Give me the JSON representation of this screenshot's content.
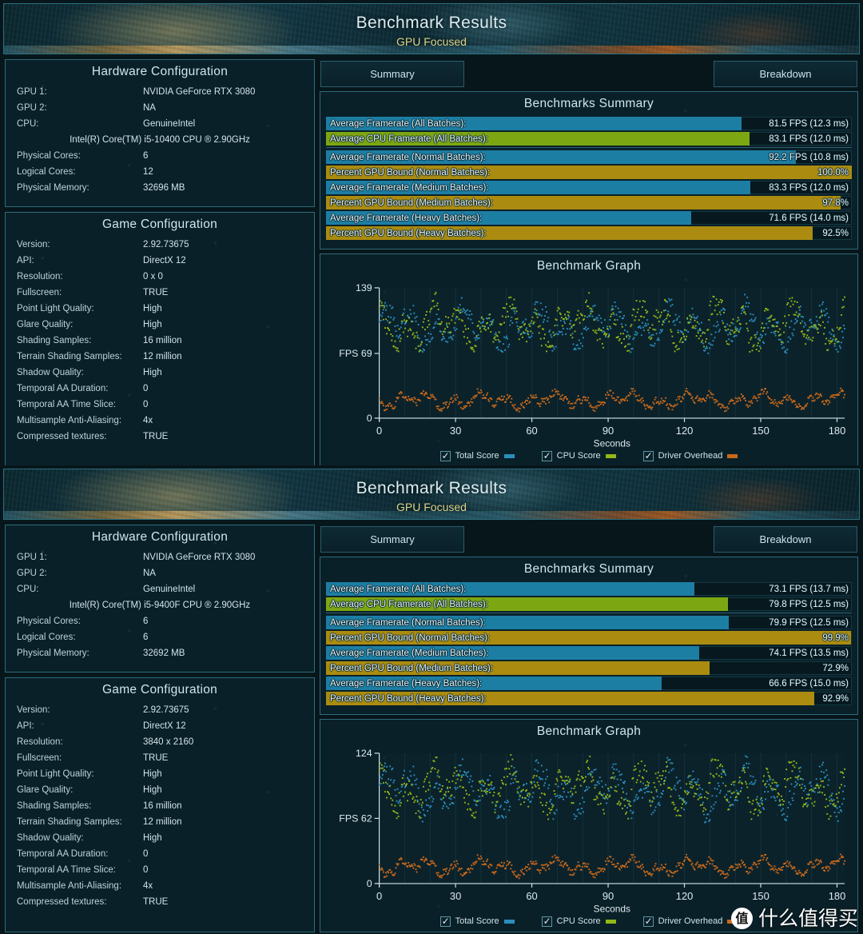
{
  "watermark": {
    "logo_char": "值",
    "text": "什么值得买"
  },
  "panels": [
    {
      "banner": {
        "title": "Benchmark Results",
        "subtitle": "GPU Focused"
      },
      "tabs": [
        {
          "label": "Summary"
        },
        {
          "label": "Breakdown"
        }
      ],
      "hardware": {
        "title": "Hardware Configuration",
        "rows": [
          {
            "key": "GPU 1:",
            "value": "NVIDIA GeForce RTX 3080"
          },
          {
            "key": "GPU 2:",
            "value": "NA"
          },
          {
            "key": "CPU:",
            "value": "GenuineIntel"
          },
          {
            "full": "Intel(R) Core(TM) i5-10400 CPU ® 2.90GHz"
          },
          {
            "key": "Physical Cores:",
            "value": "6"
          },
          {
            "key": "Logical Cores:",
            "value": "12"
          },
          {
            "key": "Physical Memory:",
            "value": "32696  MB"
          }
        ]
      },
      "game": {
        "title": "Game Configuration",
        "rows": [
          {
            "key": "Version:",
            "value": "2.92.73675"
          },
          {
            "key": "API:",
            "value": "DirectX 12"
          },
          {
            "key": "Resolution:",
            "value": "0 x 0"
          },
          {
            "key": "Fullscreen:",
            "value": "TRUE"
          },
          {
            "key": "Point Light Quality:",
            "value": "High"
          },
          {
            "key": "Glare Quality:",
            "value": "High"
          },
          {
            "key": "Shading Samples:",
            "value": "16 million"
          },
          {
            "key": "Terrain Shading Samples:",
            "value": "12 million"
          },
          {
            "key": "Shadow Quality:",
            "value": "High"
          },
          {
            "key": "Temporal AA Duration:",
            "value": "0"
          },
          {
            "key": "Temporal AA Time Slice:",
            "value": "0"
          },
          {
            "key": "Multisample Anti-Aliasing:",
            "value": "4x"
          },
          {
            "key": "Compressed textures:",
            "value": "TRUE"
          }
        ]
      },
      "summary": {
        "title": "Benchmarks Summary",
        "bars": [
          {
            "label": "Average Framerate (All Batches):",
            "value": "81.5 FPS (12.3 ms)",
            "color": "blue",
            "pct": 79.0
          },
          {
            "label": "Average CPU Framerate (All Batches):",
            "value": "83.1 FPS (12.0 ms)",
            "color": "green",
            "pct": 80.5
          },
          {
            "label": "Average Framerate (Normal Batches):",
            "value": "92.2 FPS (10.8 ms)",
            "color": "blue",
            "pct": 89.4
          },
          {
            "label": "Percent GPU Bound (Normal Batches):",
            "value": "100.0%",
            "color": "gold",
            "pct": 100.0
          },
          {
            "label": "Average Framerate (Medium Batches):",
            "value": "83.3 FPS (12.0 ms)",
            "color": "blue",
            "pct": 80.7
          },
          {
            "label": "Percent GPU Bound (Medium Batches):",
            "value": "97.8%",
            "color": "gold",
            "pct": 97.8
          },
          {
            "label": "Average Framerate (Heavy Batches):",
            "value": "71.6 FPS (14.0 ms)",
            "color": "blue",
            "pct": 69.5
          },
          {
            "label": "Percent GPU Bound (Heavy Batches):",
            "value": "92.5%",
            "color": "gold",
            "pct": 92.5
          }
        ]
      },
      "graph": {
        "title": "Benchmark Graph",
        "y_top": "139",
        "y_mid_label": "FPS",
        "y_mid": "69",
        "y_bottom": "0",
        "xlabel": "Seconds",
        "xticks": [
          "0",
          "30",
          "60",
          "90",
          "120",
          "150",
          "180"
        ],
        "legend": [
          {
            "label": "Total Score",
            "color": "#2b8fbd"
          },
          {
            "label": "CPU Score",
            "color": "#93b817"
          },
          {
            "label": "Driver Overhead",
            "color": "#c9691a"
          }
        ]
      },
      "chart_data": {
        "type": "scatter",
        "title": "Benchmark Graph",
        "xlabel": "Seconds",
        "ylabel": "FPS",
        "xlim": [
          0,
          183
        ],
        "ylim": [
          0,
          139
        ],
        "yticks": [
          0,
          69,
          139
        ],
        "xticks": [
          0,
          30,
          60,
          90,
          120,
          150,
          180
        ],
        "grid": true,
        "legend_position": "bottom",
        "series": [
          {
            "name": "Total Score",
            "color": "#2b8fbd",
            "mean": 97,
            "min": 69,
            "max": 132
          },
          {
            "name": "CPU Score",
            "color": "#93b817",
            "mean": 99,
            "min": 70,
            "max": 138
          },
          {
            "name": "Driver Overhead",
            "color": "#c9691a",
            "mean": 19,
            "min": 7,
            "max": 32
          }
        ]
      }
    },
    {
      "banner": {
        "title": "Benchmark Results",
        "subtitle": "GPU Focused"
      },
      "tabs": [
        {
          "label": "Summary"
        },
        {
          "label": "Breakdown"
        }
      ],
      "hardware": {
        "title": "Hardware Configuration",
        "rows": [
          {
            "key": "GPU 1:",
            "value": "NVIDIA GeForce RTX 3080"
          },
          {
            "key": "GPU 2:",
            "value": "NA"
          },
          {
            "key": "CPU:",
            "value": "GenuineIntel"
          },
          {
            "full": "Intel(R) Core(TM) i5-9400F CPU ® 2.90GHz"
          },
          {
            "key": "Physical Cores:",
            "value": "6"
          },
          {
            "key": "Logical Cores:",
            "value": "6"
          },
          {
            "key": "Physical Memory:",
            "value": "32692  MB"
          }
        ]
      },
      "game": {
        "title": "Game Configuration",
        "rows": [
          {
            "key": "Version:",
            "value": "2.92.73675"
          },
          {
            "key": "API:",
            "value": "DirectX 12"
          },
          {
            "key": "Resolution:",
            "value": "3840 x 2160"
          },
          {
            "key": "Fullscreen:",
            "value": "TRUE"
          },
          {
            "key": "Point Light Quality:",
            "value": "High"
          },
          {
            "key": "Glare Quality:",
            "value": "High"
          },
          {
            "key": "Shading Samples:",
            "value": "16 million"
          },
          {
            "key": "Terrain Shading Samples:",
            "value": "12 million"
          },
          {
            "key": "Shadow Quality:",
            "value": "High"
          },
          {
            "key": "Temporal AA Duration:",
            "value": "0"
          },
          {
            "key": "Temporal AA Time Slice:",
            "value": "0"
          },
          {
            "key": "Multisample Anti-Aliasing:",
            "value": "4x"
          },
          {
            "key": "Compressed textures:",
            "value": "TRUE"
          }
        ]
      },
      "summary": {
        "title": "Benchmarks Summary",
        "bars": [
          {
            "label": "Average Framerate (All Batches):",
            "value": "73.1 FPS (13.7 ms)",
            "color": "blue",
            "pct": 70.0
          },
          {
            "label": "Average CPU Framerate (All Batches):",
            "value": "79.8 FPS (12.5 ms)",
            "color": "green",
            "pct": 76.5
          },
          {
            "label": "Average Framerate (Normal Batches):",
            "value": "79.9 FPS (12.5 ms)",
            "color": "blue",
            "pct": 76.6
          },
          {
            "label": "Percent GPU Bound (Normal Batches):",
            "value": "99.9%",
            "color": "gold",
            "pct": 99.9
          },
          {
            "label": "Average Framerate (Medium Batches):",
            "value": "74.1 FPS (13.5 ms)",
            "color": "blue",
            "pct": 71.0
          },
          {
            "label": "Percent GPU Bound (Medium Batches):",
            "value": "72.9%",
            "color": "gold",
            "pct": 72.9
          },
          {
            "label": "Average Framerate (Heavy Batches):",
            "value": "66.6 FPS (15.0 ms)",
            "color": "blue",
            "pct": 63.8
          },
          {
            "label": "Percent GPU Bound (Heavy Batches):",
            "value": "92.9%",
            "color": "gold",
            "pct": 92.9
          }
        ]
      },
      "graph": {
        "title": "Benchmark Graph",
        "y_top": "124",
        "y_mid_label": "FPS",
        "y_mid": "62",
        "y_bottom": "0",
        "xlabel": "Seconds",
        "xticks": [
          "0",
          "30",
          "60",
          "90",
          "120",
          "150",
          "180"
        ],
        "legend": [
          {
            "label": "Total Score",
            "color": "#2b8fbd"
          },
          {
            "label": "CPU Score",
            "color": "#93b817"
          },
          {
            "label": "Driver Overhead",
            "color": "#c9691a"
          }
        ]
      },
      "chart_data": {
        "type": "scatter",
        "title": "Benchmark Graph",
        "xlabel": "Seconds",
        "ylabel": "FPS",
        "xlim": [
          0,
          183
        ],
        "ylim": [
          0,
          124
        ],
        "yticks": [
          0,
          62,
          124
        ],
        "xticks": [
          0,
          30,
          60,
          90,
          120,
          150,
          180
        ],
        "grid": true,
        "legend_position": "bottom",
        "series": [
          {
            "name": "Total Score",
            "color": "#2b8fbd",
            "mean": 88,
            "min": 58,
            "max": 122
          },
          {
            "name": "CPU Score",
            "color": "#93b817",
            "mean": 90,
            "min": 60,
            "max": 124
          },
          {
            "name": "Driver Overhead",
            "color": "#c9691a",
            "mean": 16,
            "min": 5,
            "max": 28
          }
        ]
      }
    }
  ]
}
